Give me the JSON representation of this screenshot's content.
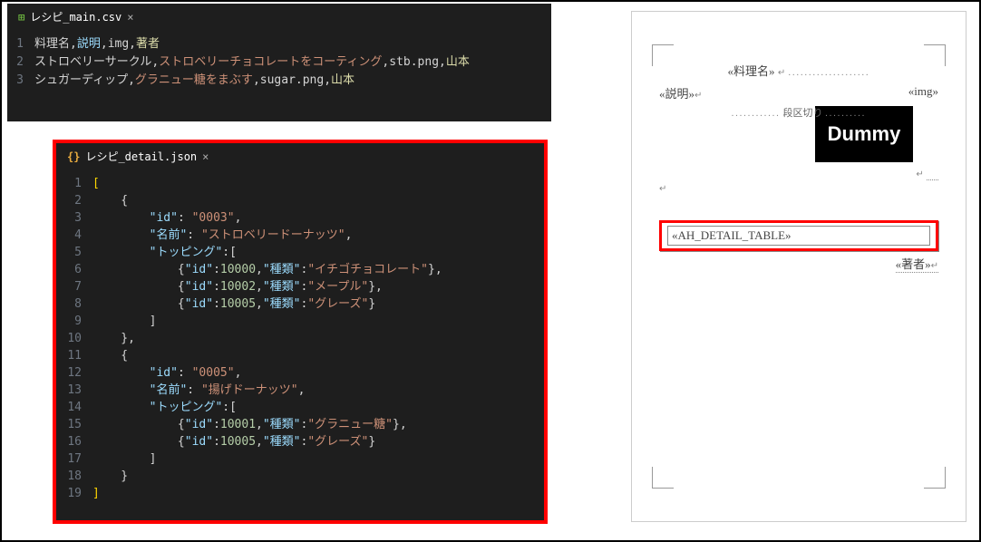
{
  "csv": {
    "tab_name": "レシピ_main.csv",
    "lines": [
      {
        "n": "1",
        "tokens": [
          {
            "t": "料理名",
            "c": "tok-header1"
          },
          {
            "t": ",",
            "c": ""
          },
          {
            "t": "説明",
            "c": "tok-header2"
          },
          {
            "t": ",",
            "c": ""
          },
          {
            "t": "img",
            "c": ""
          },
          {
            "t": ",",
            "c": ""
          },
          {
            "t": "著者",
            "c": "tok-author"
          }
        ]
      },
      {
        "n": "2",
        "tokens": [
          {
            "t": "ストロベリーサークル",
            "c": ""
          },
          {
            "t": ",",
            "c": ""
          },
          {
            "t": "ストロベリーチョコレートをコーティング",
            "c": "tok-str"
          },
          {
            "t": ",",
            "c": ""
          },
          {
            "t": "stb.png",
            "c": ""
          },
          {
            "t": ",",
            "c": ""
          },
          {
            "t": "山本",
            "c": "tok-author"
          }
        ]
      },
      {
        "n": "3",
        "tokens": [
          {
            "t": "シュガーディップ",
            "c": ""
          },
          {
            "t": ",",
            "c": ""
          },
          {
            "t": "グラニュー糖をまぶす",
            "c": "tok-str"
          },
          {
            "t": ",",
            "c": ""
          },
          {
            "t": "sugar.png",
            "c": ""
          },
          {
            "t": ",",
            "c": ""
          },
          {
            "t": "山本",
            "c": "tok-author"
          }
        ]
      }
    ]
  },
  "json": {
    "tab_name": "レシピ_detail.json",
    "lines": [
      {
        "n": "1",
        "seg": [
          {
            "t": "[",
            "c": "tok-bracket"
          }
        ]
      },
      {
        "n": "2",
        "seg": [
          {
            "t": "    {",
            "c": ""
          }
        ]
      },
      {
        "n": "3",
        "seg": [
          {
            "t": "        ",
            "c": ""
          },
          {
            "t": "\"id\"",
            "c": "tok-key"
          },
          {
            "t": ": ",
            "c": ""
          },
          {
            "t": "\"0003\"",
            "c": "tok-value-str"
          },
          {
            "t": ",",
            "c": ""
          }
        ]
      },
      {
        "n": "4",
        "seg": [
          {
            "t": "        ",
            "c": ""
          },
          {
            "t": "\"名前\"",
            "c": "tok-key"
          },
          {
            "t": ": ",
            "c": ""
          },
          {
            "t": "\"ストロベリードーナッツ\"",
            "c": "tok-value-str"
          },
          {
            "t": ",",
            "c": ""
          }
        ]
      },
      {
        "n": "5",
        "seg": [
          {
            "t": "        ",
            "c": ""
          },
          {
            "t": "\"トッピング\"",
            "c": "tok-key"
          },
          {
            "t": ":[",
            "c": ""
          }
        ]
      },
      {
        "n": "6",
        "seg": [
          {
            "t": "            {",
            "c": ""
          },
          {
            "t": "\"id\"",
            "c": "tok-key"
          },
          {
            "t": ":",
            "c": ""
          },
          {
            "t": "10000",
            "c": "tok-value-num"
          },
          {
            "t": ",",
            "c": ""
          },
          {
            "t": "\"種類\"",
            "c": "tok-key"
          },
          {
            "t": ":",
            "c": ""
          },
          {
            "t": "\"イチゴチョコレート\"",
            "c": "tok-value-str"
          },
          {
            "t": "},",
            "c": ""
          }
        ]
      },
      {
        "n": "7",
        "seg": [
          {
            "t": "            {",
            "c": ""
          },
          {
            "t": "\"id\"",
            "c": "tok-key"
          },
          {
            "t": ":",
            "c": ""
          },
          {
            "t": "10002",
            "c": "tok-value-num"
          },
          {
            "t": ",",
            "c": ""
          },
          {
            "t": "\"種類\"",
            "c": "tok-key"
          },
          {
            "t": ":",
            "c": ""
          },
          {
            "t": "\"メープル\"",
            "c": "tok-value-str"
          },
          {
            "t": "},",
            "c": ""
          }
        ]
      },
      {
        "n": "8",
        "seg": [
          {
            "t": "            {",
            "c": ""
          },
          {
            "t": "\"id\"",
            "c": "tok-key"
          },
          {
            "t": ":",
            "c": ""
          },
          {
            "t": "10005",
            "c": "tok-value-num"
          },
          {
            "t": ",",
            "c": ""
          },
          {
            "t": "\"種類\"",
            "c": "tok-key"
          },
          {
            "t": ":",
            "c": ""
          },
          {
            "t": "\"グレーズ\"",
            "c": "tok-value-str"
          },
          {
            "t": "}",
            "c": ""
          }
        ]
      },
      {
        "n": "9",
        "seg": [
          {
            "t": "        ]",
            "c": ""
          }
        ]
      },
      {
        "n": "10",
        "seg": [
          {
            "t": "    },",
            "c": ""
          }
        ]
      },
      {
        "n": "11",
        "seg": [
          {
            "t": "    {",
            "c": ""
          }
        ]
      },
      {
        "n": "12",
        "seg": [
          {
            "t": "        ",
            "c": ""
          },
          {
            "t": "\"id\"",
            "c": "tok-key"
          },
          {
            "t": ": ",
            "c": ""
          },
          {
            "t": "\"0005\"",
            "c": "tok-value-str"
          },
          {
            "t": ",",
            "c": ""
          }
        ]
      },
      {
        "n": "13",
        "seg": [
          {
            "t": "        ",
            "c": ""
          },
          {
            "t": "\"名前\"",
            "c": "tok-key"
          },
          {
            "t": ": ",
            "c": ""
          },
          {
            "t": "\"揚げドーナッツ\"",
            "c": "tok-value-str"
          },
          {
            "t": ",",
            "c": ""
          }
        ]
      },
      {
        "n": "14",
        "seg": [
          {
            "t": "        ",
            "c": ""
          },
          {
            "t": "\"トッピング\"",
            "c": "tok-key"
          },
          {
            "t": ":[",
            "c": ""
          }
        ]
      },
      {
        "n": "15",
        "seg": [
          {
            "t": "            {",
            "c": ""
          },
          {
            "t": "\"id\"",
            "c": "tok-key"
          },
          {
            "t": ":",
            "c": ""
          },
          {
            "t": "10001",
            "c": "tok-value-num"
          },
          {
            "t": ",",
            "c": ""
          },
          {
            "t": "\"種類\"",
            "c": "tok-key"
          },
          {
            "t": ":",
            "c": ""
          },
          {
            "t": "\"グラニュー糖\"",
            "c": "tok-value-str"
          },
          {
            "t": "},",
            "c": ""
          }
        ]
      },
      {
        "n": "16",
        "seg": [
          {
            "t": "            {",
            "c": ""
          },
          {
            "t": "\"id\"",
            "c": "tok-key"
          },
          {
            "t": ":",
            "c": ""
          },
          {
            "t": "10005",
            "c": "tok-value-num"
          },
          {
            "t": ",",
            "c": ""
          },
          {
            "t": "\"種類\"",
            "c": "tok-key"
          },
          {
            "t": ":",
            "c": ""
          },
          {
            "t": "\"グレーズ\"",
            "c": "tok-value-str"
          },
          {
            "t": "}",
            "c": ""
          }
        ]
      },
      {
        "n": "17",
        "seg": [
          {
            "t": "        ]",
            "c": ""
          }
        ]
      },
      {
        "n": "18",
        "seg": [
          {
            "t": "    }",
            "c": ""
          }
        ]
      },
      {
        "n": "19",
        "seg": [
          {
            "t": "]",
            "c": "tok-bracket"
          }
        ]
      }
    ]
  },
  "doc": {
    "title_field": "«料理名»",
    "description_field": "«説明»",
    "img_field": "«img»",
    "section_break": "段区切り",
    "dummy": "Dummy",
    "detail_table": "«AH_DETAIL_TABLE»",
    "author_field": "«著者»",
    "para_mark": "↵",
    "dots_right": "....................",
    "dots_desc": "............",
    "dots_break": ".........."
  }
}
